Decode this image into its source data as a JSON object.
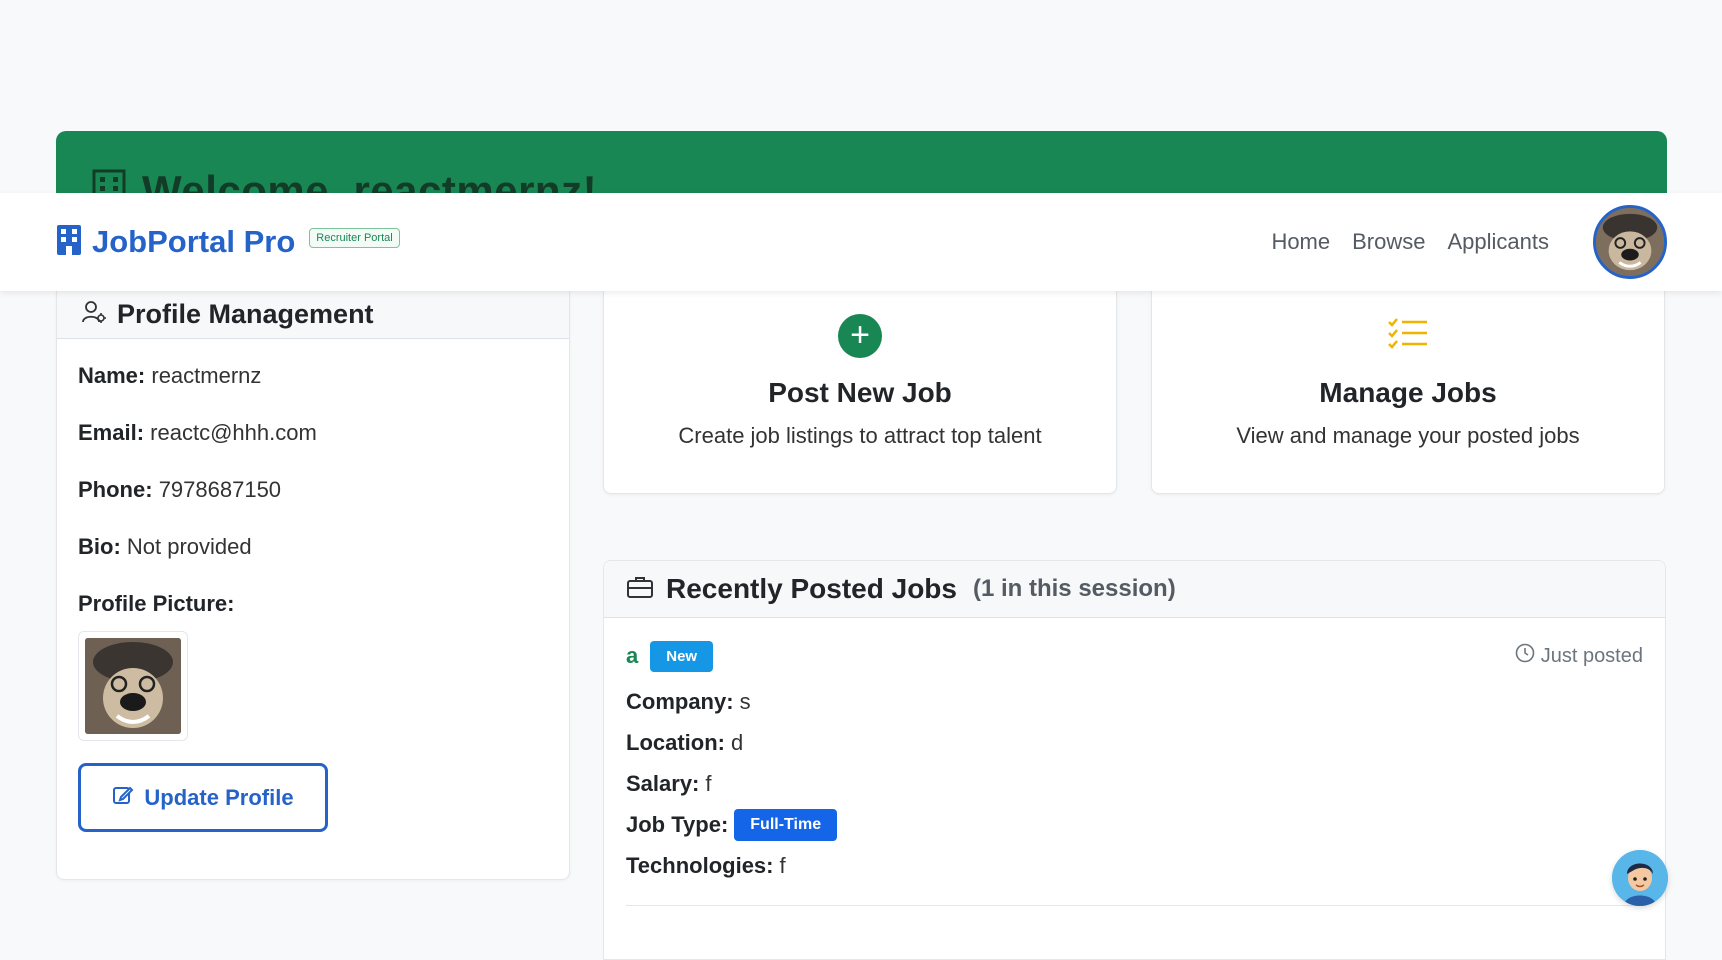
{
  "welcome": {
    "title": "Welcome, reactmernz!"
  },
  "navbar": {
    "brand": "JobPortal Pro",
    "badge": "Recruiter Portal",
    "links": [
      "Home",
      "Browse",
      "Applicants"
    ]
  },
  "profile": {
    "header": "Profile Management",
    "name_label": "Name:",
    "name": "reactmernz",
    "email_label": "Email:",
    "email": "reactc@hhh.com",
    "phone_label": "Phone:",
    "phone": "7978687150",
    "bio_label": "Bio:",
    "bio": "Not provided",
    "picture_label": "Profile Picture:",
    "update_button": "Update Profile"
  },
  "actions": {
    "post": {
      "title": "Post New Job",
      "desc": "Create job listings to attract top talent"
    },
    "manage": {
      "title": "Manage Jobs",
      "desc": "View and manage your posted jobs"
    }
  },
  "recent_jobs": {
    "title": "Recently Posted Jobs",
    "count": "(1 in this session)",
    "items": [
      {
        "title": "a",
        "badge": "New",
        "posted": "Just posted",
        "company_label": "Company:",
        "company": "s",
        "location_label": "Location:",
        "location": "d",
        "salary_label": "Salary:",
        "salary": "f",
        "job_type_label": "Job Type:",
        "job_type": "Full-Time",
        "technologies_label": "Technologies:",
        "technologies": "f"
      }
    ]
  },
  "colors": {
    "primary": "#2563c9",
    "success": "#198754",
    "info": "#1597e5",
    "warning": "#f0b400"
  },
  "icons": {
    "brand": "building-icon",
    "profile": "user-gear-icon",
    "post": "plus-circle-icon",
    "manage": "list-check-icon",
    "jobs": "briefcase-icon",
    "posted": "clock-icon",
    "update": "edit-icon",
    "chat": "chatbot-avatar-icon"
  }
}
